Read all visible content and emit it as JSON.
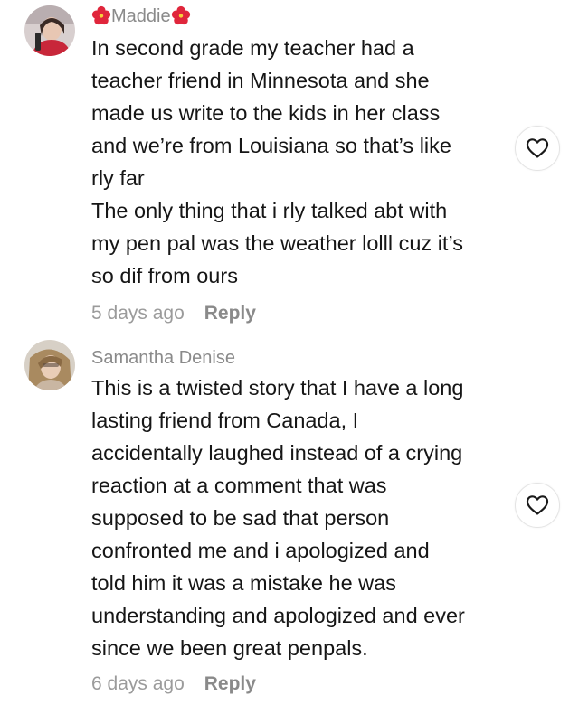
{
  "comments": [
    {
      "username": "Maddie",
      "username_decoration": "hibiscus-icon",
      "text": "In second grade my teacher had a\nteacher friend in Minnesota and she\nmade us write to the kids in her class\nand we’re from Louisiana so that’s like\nrly far\nThe only thing that i rly talked abt with\nmy pen pal was the weather lolll cuz it’s\nso dif from ours",
      "time": "5 days ago",
      "reply_label": "Reply"
    },
    {
      "username": "Samantha Denise",
      "text": "This is a twisted story that I have a long\nlasting friend from Canada, I\naccidentally laughed instead of a crying\nreaction at a comment that was\nsupposed to be sad that person\nconfronted me and i apologized and\ntold him it was a mistake he was\nunderstanding and apologized and ever\nsince we been great penpals.",
      "time": "6 days ago",
      "reply_label": "Reply"
    }
  ],
  "colors": {
    "hibiscus": "#e0263c",
    "meta_text": "#9b9b9b",
    "like_border": "#e4e4e4"
  }
}
